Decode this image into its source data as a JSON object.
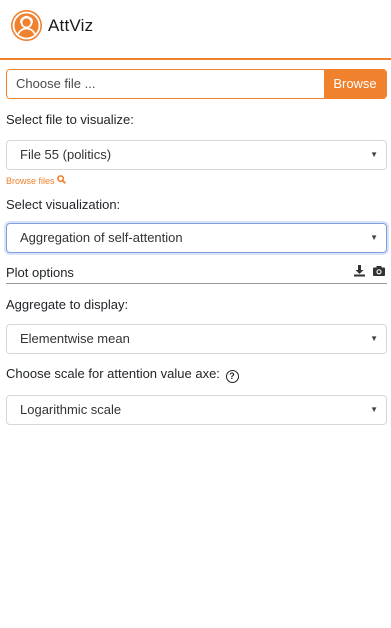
{
  "app": {
    "name": "AttViz",
    "logo_icon": "person-avatar-icon",
    "accent_color": "#f0812d"
  },
  "file_input": {
    "placeholder": "Choose file ...",
    "browse_label": "Browse"
  },
  "file_select": {
    "label": "Select file to visualize:",
    "value": "File 55 (politics)",
    "browse_files_label": "Browse files"
  },
  "visualization_select": {
    "label": "Select visualization:",
    "value": "Aggregation of self-attention"
  },
  "plot_options": {
    "label": "Plot options",
    "icons": [
      "download-icon",
      "camera-icon"
    ]
  },
  "aggregate_select": {
    "label": "Aggregate to display:",
    "value": "Elementwise mean"
  },
  "scale_select": {
    "label": "Choose scale for attention value axe:",
    "value": "Logarithmic scale",
    "help_symbol": "?"
  }
}
